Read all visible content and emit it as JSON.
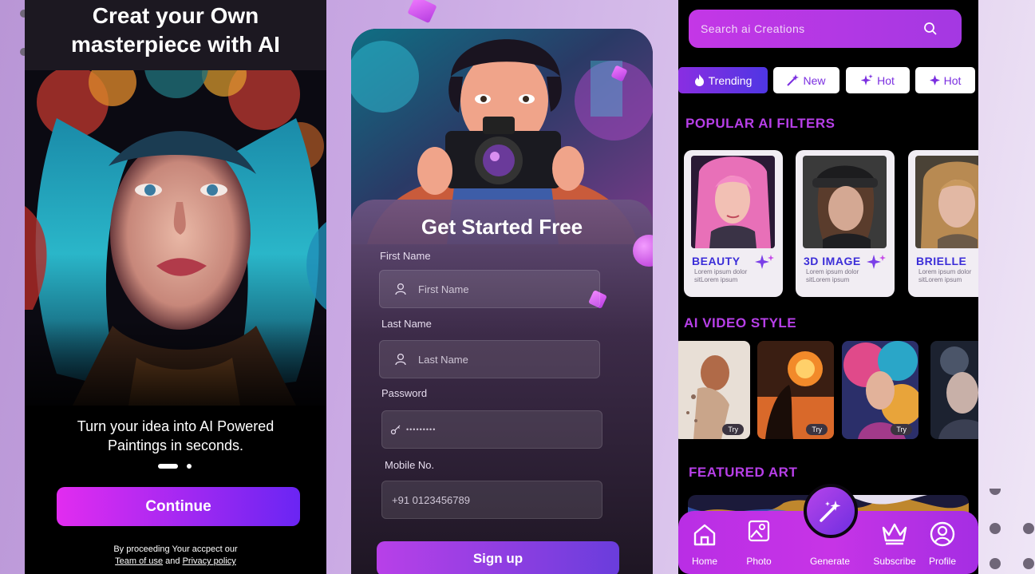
{
  "onboarding": {
    "title": "Creat your Own\nmasterpiece with AI",
    "tagline": "Turn your idea into AI Powered\nPaintings in seconds.",
    "continue_label": "Continue",
    "legal_line1": "By proceeding Your accpect our",
    "legal_link_terms": "Team of use",
    "legal_and": " and ",
    "legal_link_privacy": "Privacy policy"
  },
  "signup": {
    "heading": "Get Started Free",
    "first_name_label": "First Name",
    "first_name_placeholder": "First Name",
    "last_name_label": "Last Name",
    "last_name_placeholder": "Last  Name",
    "password_label": "Password",
    "password_value": "•••••••••",
    "mobile_label": "Mobile No.",
    "mobile_value": "+91 0123456789",
    "signup_label": "Sign up"
  },
  "home": {
    "search_placeholder": "Search ai Creations",
    "chips": [
      {
        "label": "Trending",
        "icon": "flame-icon"
      },
      {
        "label": "New",
        "icon": "magic-wand-icon"
      },
      {
        "label": "Hot",
        "icon": "sparkle-icon"
      },
      {
        "label": "Hot",
        "icon": "sparkle-icon"
      }
    ],
    "popular_title": "POPULAR AI FILTERS",
    "filters": [
      {
        "name": "BEAUTY",
        "desc": "Lorem ipsum dolor sitLorem ipsum"
      },
      {
        "name": "3D IMAGE",
        "desc": "Lorem ipsum dolor sitLorem ipsum"
      },
      {
        "name": "BRIELLE",
        "desc": "Lorem ipsum dolor sitLorem ipsum"
      }
    ],
    "video_title": "AI VIDEO STYLE",
    "try_label": "Try",
    "featured_title": "FEATURED ART",
    "nav": [
      {
        "label": "Home",
        "icon": "home-icon"
      },
      {
        "label": "Photo",
        "icon": "photo-icon"
      },
      {
        "label": "Generate",
        "icon": "magic-wand-icon"
      },
      {
        "label": "Subscribe",
        "icon": "crown-icon"
      },
      {
        "label": "Profile",
        "icon": "profile-icon"
      }
    ]
  },
  "colors": {
    "accent_magenta": "#e22cf0",
    "accent_violet": "#6a25f3",
    "section_title": "#b73fe8"
  }
}
